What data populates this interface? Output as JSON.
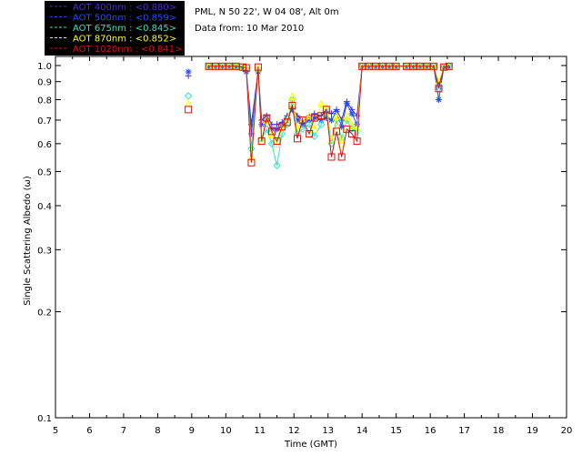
{
  "info": {
    "line1": "PML, N 50 22', W 04 08', Alt 0m",
    "line2": "Data from: 10 Mar 2010"
  },
  "colors": {
    "legend_bg": "#000000",
    "axis": "#000000"
  },
  "chart_data": {
    "type": "line",
    "xlabel": "Time (GMT)",
    "ylabel": "Single Scattering Albedo (ω)",
    "xlim": [
      5,
      20
    ],
    "ylim": [
      0.1,
      1.0
    ],
    "yscale": "log",
    "xticks": [
      5,
      6,
      7,
      8,
      9,
      10,
      11,
      12,
      13,
      14,
      15,
      16,
      17,
      18,
      19,
      20
    ],
    "yticks": [
      {
        "value": 0.1,
        "label": "0.1"
      },
      {
        "value": 0.2,
        "label": "0.2"
      },
      {
        "value": 0.3,
        "label": "0.3"
      },
      {
        "value": 0.4,
        "label": "0.4"
      },
      {
        "value": 0.5,
        "label": "0.5"
      },
      {
        "value": 0.6,
        "label": "0.6"
      },
      {
        "value": 0.7,
        "label": "0.7"
      },
      {
        "value": 0.8,
        "label": "0.8"
      },
      {
        "value": 0.9,
        "label": "0.9"
      },
      {
        "value": 1.0,
        "label": "1.0"
      }
    ],
    "legend_position": "top-left, outside plot",
    "series": [
      {
        "name": "AOT 400nm : <0.880>",
        "color": "#4b2bd6",
        "marker": "plus",
        "x": [
          8.9,
          9.5,
          9.7,
          9.9,
          10.1,
          10.3,
          10.5,
          10.6,
          10.75,
          10.95,
          11.05,
          11.2,
          11.35,
          11.5,
          11.65,
          11.8,
          11.95,
          12.1,
          12.25,
          12.45,
          12.6,
          12.8,
          12.95,
          13.1,
          13.25,
          13.4,
          13.55,
          13.7,
          13.85,
          14.0,
          14.2,
          14.4,
          14.6,
          14.8,
          15.0,
          15.3,
          15.5,
          15.7,
          15.9,
          16.1,
          16.25,
          16.4,
          16.55
        ],
        "y": [
          0.935,
          0.995,
          0.995,
          0.995,
          0.995,
          0.995,
          0.985,
          0.97,
          0.68,
          0.97,
          0.7,
          0.72,
          0.68,
          0.68,
          0.69,
          0.72,
          0.76,
          0.72,
          0.7,
          0.72,
          0.73,
          0.72,
          0.74,
          0.73,
          0.75,
          0.7,
          0.79,
          0.75,
          0.72,
          0.995,
          0.995,
          0.995,
          0.995,
          0.995,
          0.995,
          0.995,
          0.995,
          0.995,
          0.995,
          0.995,
          0.88,
          0.99,
          0.995
        ]
      },
      {
        "name": "AOT 500nm : <0.859>",
        "color": "#1a4dff",
        "marker": "asterisk",
        "x": [
          8.9,
          9.5,
          9.7,
          9.9,
          10.1,
          10.3,
          10.5,
          10.6,
          10.75,
          10.95,
          11.05,
          11.2,
          11.35,
          11.5,
          11.65,
          11.8,
          11.95,
          12.1,
          12.25,
          12.45,
          12.6,
          12.8,
          12.95,
          13.1,
          13.25,
          13.4,
          13.55,
          13.7,
          13.85,
          14.0,
          14.2,
          14.4,
          14.6,
          14.8,
          15.0,
          15.3,
          15.5,
          15.7,
          15.9,
          16.1,
          16.25,
          16.4,
          16.55
        ],
        "y": [
          0.96,
          0.995,
          0.995,
          0.995,
          0.995,
          0.995,
          0.98,
          0.96,
          0.64,
          0.96,
          0.68,
          0.7,
          0.66,
          0.66,
          0.67,
          0.71,
          0.75,
          0.7,
          0.68,
          0.7,
          0.71,
          0.7,
          0.71,
          0.7,
          0.74,
          0.67,
          0.78,
          0.73,
          0.68,
          0.995,
          0.995,
          0.995,
          0.995,
          0.995,
          0.995,
          0.995,
          0.995,
          0.995,
          0.995,
          0.995,
          0.8,
          0.99,
          0.995
        ]
      },
      {
        "name": "AOT 675nm : <0.845>",
        "color": "#2ee6c0",
        "marker": "diamond",
        "x": [
          8.9,
          9.5,
          9.7,
          9.9,
          10.1,
          10.3,
          10.5,
          10.6,
          10.75,
          10.95,
          11.05,
          11.2,
          11.35,
          11.5,
          11.65,
          11.8,
          11.95,
          12.1,
          12.25,
          12.45,
          12.6,
          12.8,
          12.95,
          13.1,
          13.25,
          13.4,
          13.55,
          13.7,
          13.85,
          14.0,
          14.2,
          14.4,
          14.6,
          14.8,
          15.0,
          15.3,
          15.5,
          15.7,
          15.9,
          16.1,
          16.25,
          16.4,
          16.55
        ],
        "y": [
          0.82,
          0.995,
          0.995,
          0.995,
          0.995,
          0.995,
          0.99,
          0.98,
          0.58,
          0.975,
          0.62,
          0.66,
          0.6,
          0.52,
          0.64,
          0.68,
          0.8,
          0.64,
          0.66,
          0.68,
          0.63,
          0.68,
          0.74,
          0.6,
          0.7,
          0.62,
          0.7,
          0.66,
          0.65,
          0.995,
          0.995,
          0.995,
          0.995,
          0.995,
          0.995,
          0.995,
          0.995,
          0.995,
          0.995,
          0.995,
          0.86,
          0.99,
          0.995
        ]
      },
      {
        "name": "AOT 870nm : <0.852>",
        "color": "#ffff00",
        "marker": "triangle",
        "x": [
          8.9,
          9.5,
          9.7,
          9.9,
          10.1,
          10.3,
          10.5,
          10.6,
          10.75,
          10.95,
          11.05,
          11.2,
          11.35,
          11.5,
          11.65,
          11.8,
          11.95,
          12.1,
          12.25,
          12.45,
          12.6,
          12.8,
          12.95,
          13.1,
          13.25,
          13.4,
          13.55,
          13.7,
          13.85,
          14.0,
          14.2,
          14.4,
          14.6,
          14.8,
          15.0,
          15.3,
          15.5,
          15.7,
          15.9,
          16.1,
          16.25,
          16.4,
          16.55
        ],
        "y": [
          0.78,
          0.995,
          0.995,
          0.995,
          0.995,
          0.995,
          0.99,
          0.985,
          0.55,
          0.985,
          0.62,
          0.7,
          0.64,
          0.6,
          0.66,
          0.7,
          0.82,
          0.66,
          0.7,
          0.72,
          0.66,
          0.78,
          0.76,
          0.62,
          0.72,
          0.6,
          0.72,
          0.68,
          0.66,
          0.995,
          0.995,
          0.995,
          0.995,
          0.995,
          0.995,
          0.995,
          0.995,
          0.995,
          0.995,
          0.995,
          0.9,
          0.99,
          0.995
        ]
      },
      {
        "name": "AOT 1020nm : <0.841>",
        "color": "#e01010",
        "marker": "square",
        "x": [
          8.9,
          9.5,
          9.7,
          9.9,
          10.1,
          10.3,
          10.5,
          10.6,
          10.75,
          10.95,
          11.05,
          11.2,
          11.35,
          11.5,
          11.65,
          11.8,
          11.95,
          12.1,
          12.25,
          12.45,
          12.6,
          12.8,
          12.95,
          13.1,
          13.25,
          13.4,
          13.55,
          13.7,
          13.85,
          14.0,
          14.2,
          14.4,
          14.6,
          14.8,
          15.0,
          15.3,
          15.5,
          15.7,
          15.9,
          16.1,
          16.25,
          16.4,
          16.55
        ],
        "y": [
          0.75,
          0.995,
          0.995,
          0.995,
          0.995,
          0.995,
          0.99,
          0.985,
          0.53,
          0.99,
          0.61,
          0.71,
          0.65,
          0.61,
          0.67,
          0.69,
          0.77,
          0.62,
          0.7,
          0.64,
          0.71,
          0.72,
          0.75,
          0.55,
          0.65,
          0.55,
          0.66,
          0.64,
          0.61,
          0.995,
          0.995,
          0.995,
          0.995,
          0.995,
          0.995,
          0.995,
          0.995,
          0.995,
          0.995,
          0.995,
          0.86,
          0.99,
          0.995
        ]
      }
    ]
  }
}
